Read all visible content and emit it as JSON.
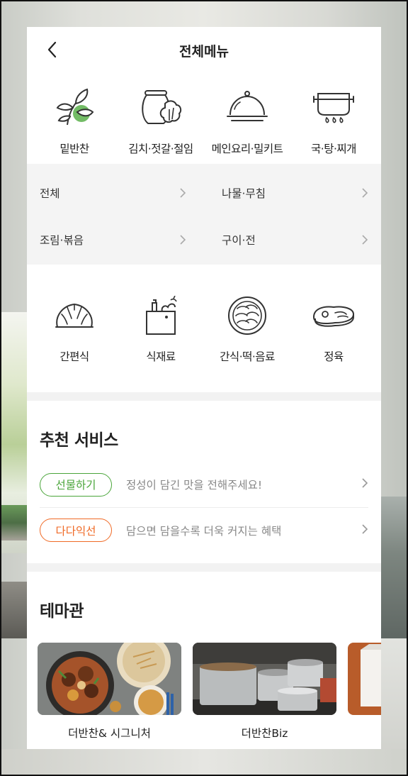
{
  "header": {
    "title": "전체메뉴"
  },
  "categories_top": [
    {
      "label": "밑반찬",
      "icon": "herb-sprout-icon"
    },
    {
      "label": "김치·젓갈·절임",
      "icon": "kimchi-jar-icon"
    },
    {
      "label": "메인요리·밀키트",
      "icon": "cloche-dish-icon"
    },
    {
      "label": "국·탕·찌개",
      "icon": "soup-pot-icon"
    }
  ],
  "submenu": [
    {
      "label": "전체"
    },
    {
      "label": "나물·무침"
    },
    {
      "label": "조림·볶음"
    },
    {
      "label": "구이·전"
    }
  ],
  "categories_bottom": [
    {
      "label": "간편식",
      "icon": "dumpling-icon"
    },
    {
      "label": "식재료",
      "icon": "grocery-bag-icon"
    },
    {
      "label": "간식·떡·음료",
      "icon": "rice-cake-plate-icon"
    },
    {
      "label": "정육",
      "icon": "steak-icon"
    }
  ],
  "recommend": {
    "title": "추천 서비스",
    "items": [
      {
        "badge": "선물하기",
        "text": "정성이 담긴 맛을 전해주세요!",
        "color": "#4aa53a"
      },
      {
        "badge": "다다익선",
        "text": "담으면 담을수록 더욱 커지는 혜택",
        "color": "#f06a26"
      }
    ]
  },
  "theme": {
    "title": "테마관",
    "cards": [
      {
        "label": "더반찬& 시그니처"
      },
      {
        "label": "더반찬Biz"
      }
    ]
  },
  "colors": {
    "brand_green": "#4aa53a",
    "accent_orange": "#f06a26",
    "icon_stroke": "#333333",
    "leaf_green": "#5bb04b"
  }
}
